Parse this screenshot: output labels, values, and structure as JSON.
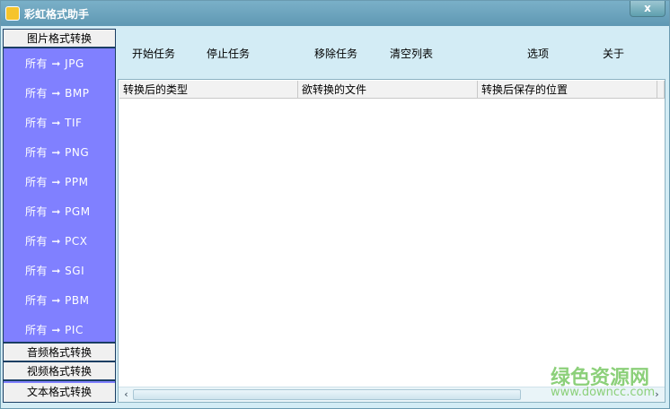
{
  "window": {
    "title": "彩虹格式助手",
    "close": "x"
  },
  "sidebar": {
    "image_category": "图片格式转换",
    "items": [
      "所有 ➞ JPG",
      "所有 ➞ BMP",
      "所有 ➞ TIF",
      "所有 ➞ PNG",
      "所有 ➞ PPM",
      "所有 ➞ PGM",
      "所有 ➞ PCX",
      "所有 ➞ SGI",
      "所有 ➞ PBM",
      "所有 ➞ PIC"
    ],
    "audio_category": "音频格式转换",
    "video_category": "视频格式转换",
    "text_category": "文本格式转换"
  },
  "toolbar": {
    "start": "开始任务",
    "stop": "停止任务",
    "remove": "移除任务",
    "clear": "清空列表",
    "options": "选项",
    "about": "关于"
  },
  "table": {
    "columns": [
      "转换后的类型",
      "欲转换的文件",
      "转换后保存的位置"
    ]
  },
  "watermark": {
    "name": "绿色资源网",
    "url": "www.downcc.com"
  }
}
